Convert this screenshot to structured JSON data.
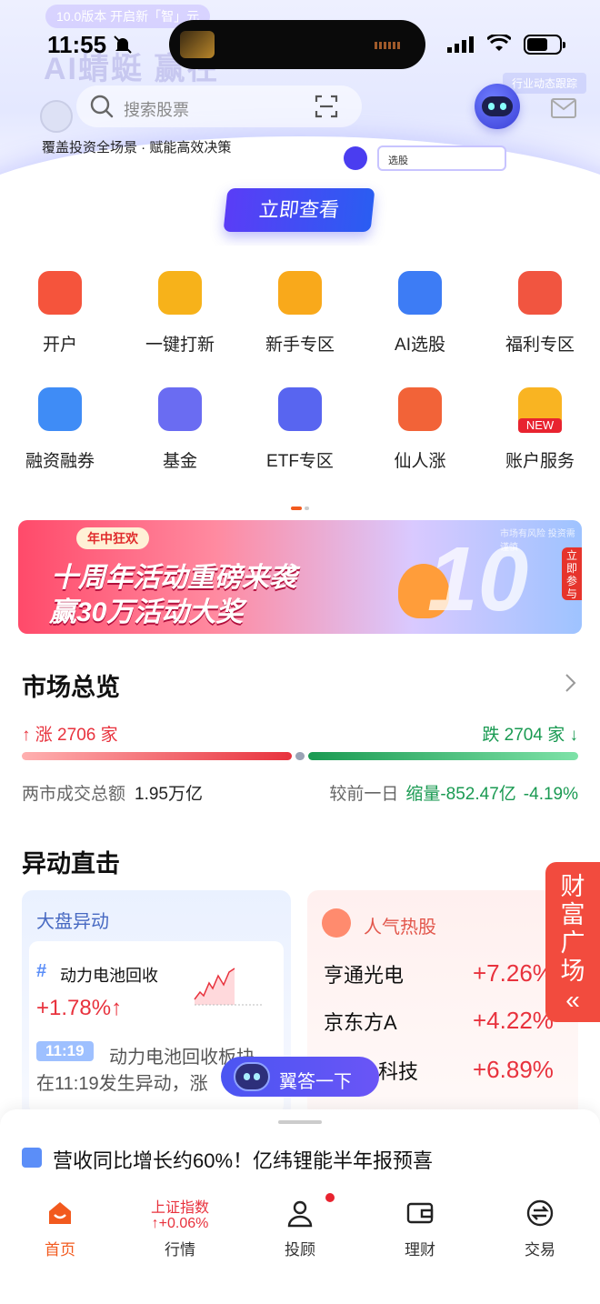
{
  "status_bar": {
    "time": "11:55"
  },
  "hero": {
    "version_badge": "10.0版本 开启新「智」元",
    "title": "AI蜻蜓 赢在",
    "search_placeholder": "搜索股票",
    "subtitle": "覆盖投资全场景 · 赋能高效决策",
    "ai_input_text": "选股",
    "top_chip": "行业动态跟踪",
    "cta_label": "立即查看"
  },
  "shortcuts": [
    {
      "label": "开户",
      "icon": "plus-icon",
      "color": "#f5543c"
    },
    {
      "label": "一键打新",
      "icon": "trend-card-icon",
      "color": "#f7b21a"
    },
    {
      "label": "新手专区",
      "icon": "yen-wallet-icon",
      "color": "#f9a91b"
    },
    {
      "label": "AI选股",
      "icon": "ai-hex-icon",
      "color": "#3d7cf5"
    },
    {
      "label": "福利专区",
      "icon": "gift-icon",
      "color": "#f15540"
    },
    {
      "label": "融资融券",
      "icon": "candlestick-icon",
      "color": "#3f8cf6"
    },
    {
      "label": "基金",
      "icon": "bar-chart-icon",
      "color": "#6a6cf2"
    },
    {
      "label": "ETF专区",
      "icon": "etf-icon",
      "color": "#5865f0"
    },
    {
      "label": "仙人涨",
      "icon": "trend-up-icon",
      "color": "#f26338"
    },
    {
      "label": "账户服务",
      "icon": "user-card-icon",
      "color": "#f9b422",
      "badge": "NEW"
    }
  ],
  "banner": {
    "tag": "年中狂欢",
    "line1": "十周年活动重磅来袭",
    "line2": "赢30万活动大奖",
    "big_number": "10",
    "disclaimer": "市场有风险 投资需谨慎",
    "side_button": "立即参与"
  },
  "market": {
    "title": "市场总览",
    "up_label": "涨 2706 家",
    "down_label": "跌 2704 家",
    "up_count": 2706,
    "down_count": 2704,
    "turnover_label": "两市成交总额",
    "turnover_value": "1.95万亿",
    "prev_label": "较前一日",
    "prev_change": "缩量-852.47亿",
    "prev_pct": "-4.19%"
  },
  "movers": {
    "title": "异动直击",
    "card_left": {
      "header": "大盘异动",
      "topic": "动力电池回收",
      "pct": "+1.78%",
      "time": "11:19",
      "desc_line1": "动力电池回收板块",
      "desc_line2": "在11:19发生异动，涨"
    },
    "card_right": {
      "header": "人气热股",
      "rows": [
        {
          "name": "亨通光电",
          "pct": "+7.26%"
        },
        {
          "name": "京东方A",
          "pct": "+4.22%"
        },
        {
          "name": "科技",
          "pct": "+6.89%"
        }
      ]
    }
  },
  "wealth_tab": "财富广场",
  "assistant_button": "翼答一下",
  "news": "营收同比增长约60%！亿纬锂能半年报预喜",
  "tabbar": {
    "items": [
      {
        "label": "首页",
        "active": true
      },
      {
        "label": "行情",
        "index_name": "上证指数",
        "index_change": "+0.06%"
      },
      {
        "label": "投顾"
      },
      {
        "label": "理财"
      },
      {
        "label": "交易"
      }
    ]
  },
  "colors": {
    "up": "#e8323d",
    "down": "#1a9a52",
    "brand": "#f25a1e"
  }
}
